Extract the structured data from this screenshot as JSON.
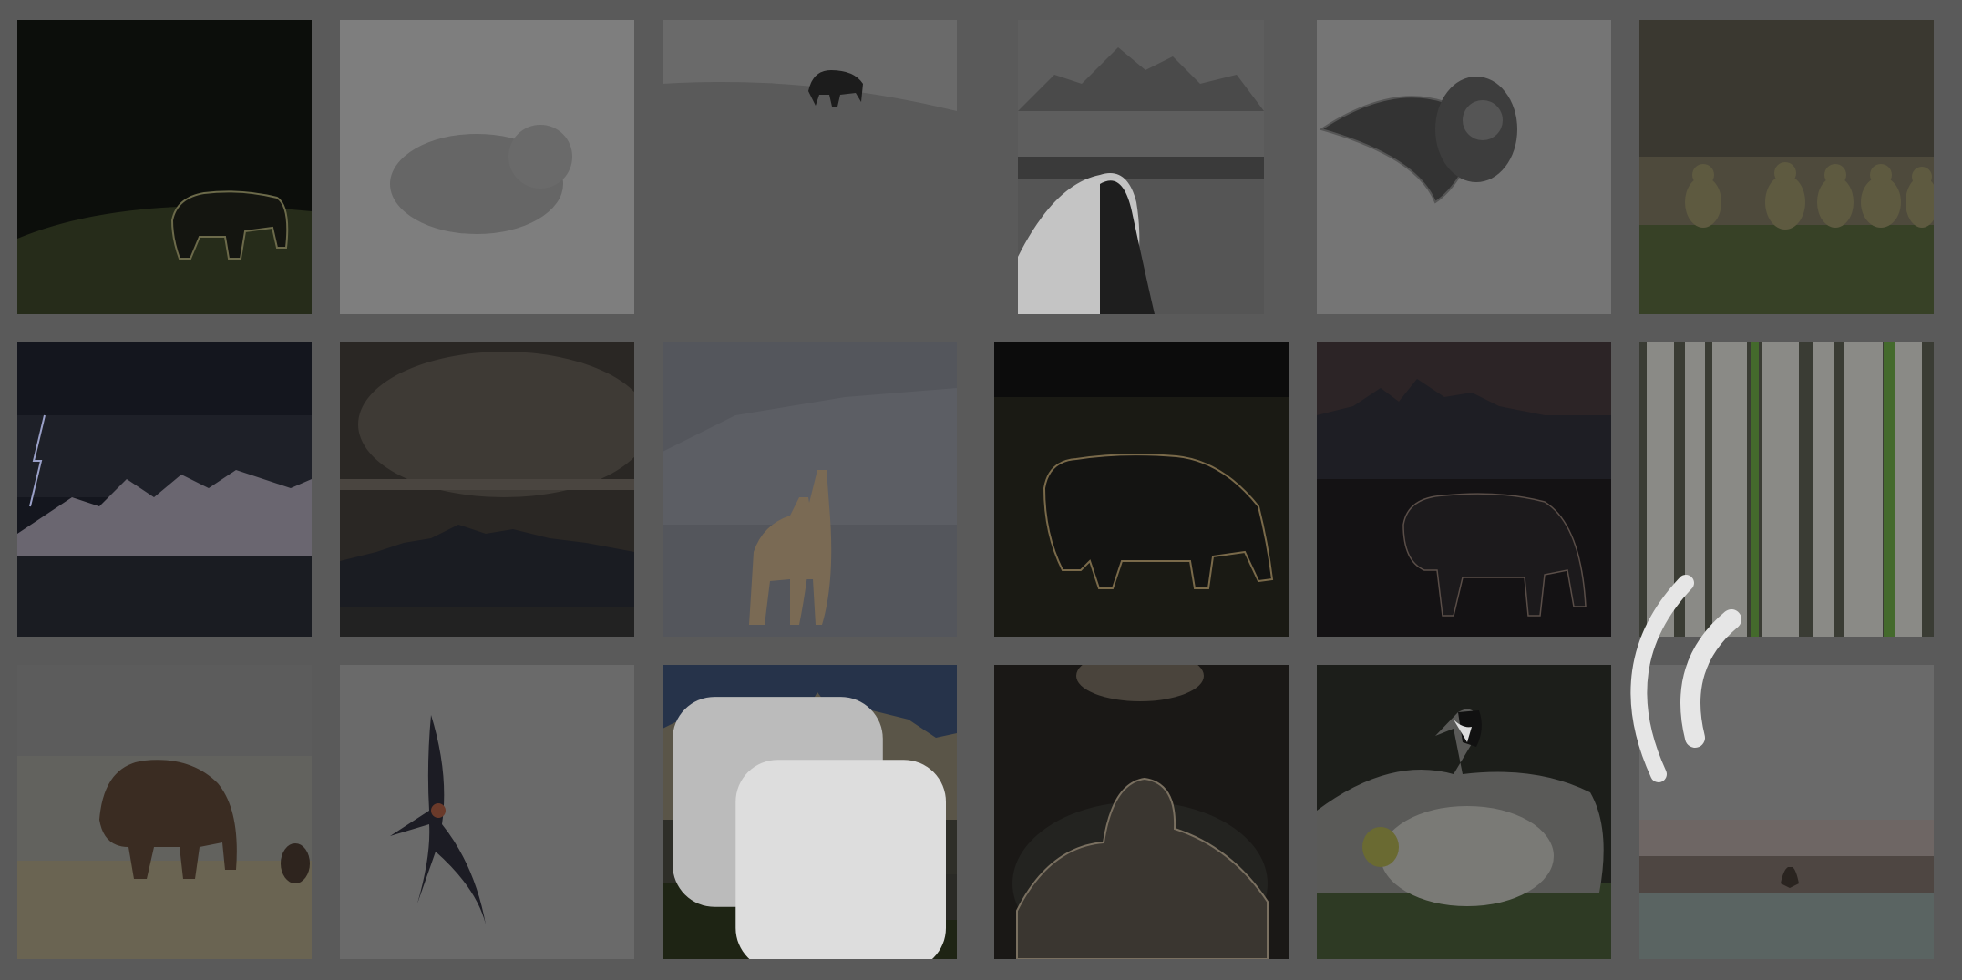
{
  "page": {
    "background": "#5a5a5a"
  },
  "gallery": {
    "tiles": [
      {
        "name": "grizzly-bear-rim-light",
        "subject": "bear"
      },
      {
        "name": "bear-in-snowstorm",
        "subject": "bear"
      },
      {
        "name": "bison-on-hillside",
        "subject": "bison"
      },
      {
        "name": "horse-and-teton-range",
        "subject": "horse"
      },
      {
        "name": "great-gray-owl-flying",
        "subject": "owl"
      },
      {
        "name": "goslings-in-row",
        "subject": "goslings"
      },
      {
        "name": "lightning-over-tetons",
        "subject": "mountains"
      },
      {
        "name": "storm-clouds-over-tetons",
        "subject": "mountains"
      },
      {
        "name": "pronghorn-pair",
        "subject": "pronghorn"
      },
      {
        "name": "bear-backlit-meadow",
        "subject": "bear"
      },
      {
        "name": "bison-under-teton-dusk",
        "subject": "bison"
      },
      {
        "name": "aspen-trunks",
        "subject": "trees"
      },
      {
        "name": "bison-on-prairie",
        "subject": "bison"
      },
      {
        "name": "swallow-in-flight",
        "subject": "bird"
      },
      {
        "name": "teton-peaks-with-barn",
        "subject": "mountains",
        "multi_photo": true
      },
      {
        "name": "backlit-gosling",
        "subject": "gosling"
      },
      {
        "name": "canada-goose-with-gosling",
        "subject": "goose"
      },
      {
        "name": "pronghorn-distant",
        "subject": "pronghorn"
      }
    ]
  },
  "loading_indicator": {
    "icon": "wifi-signal-icon",
    "color": "#e6e6e6"
  }
}
